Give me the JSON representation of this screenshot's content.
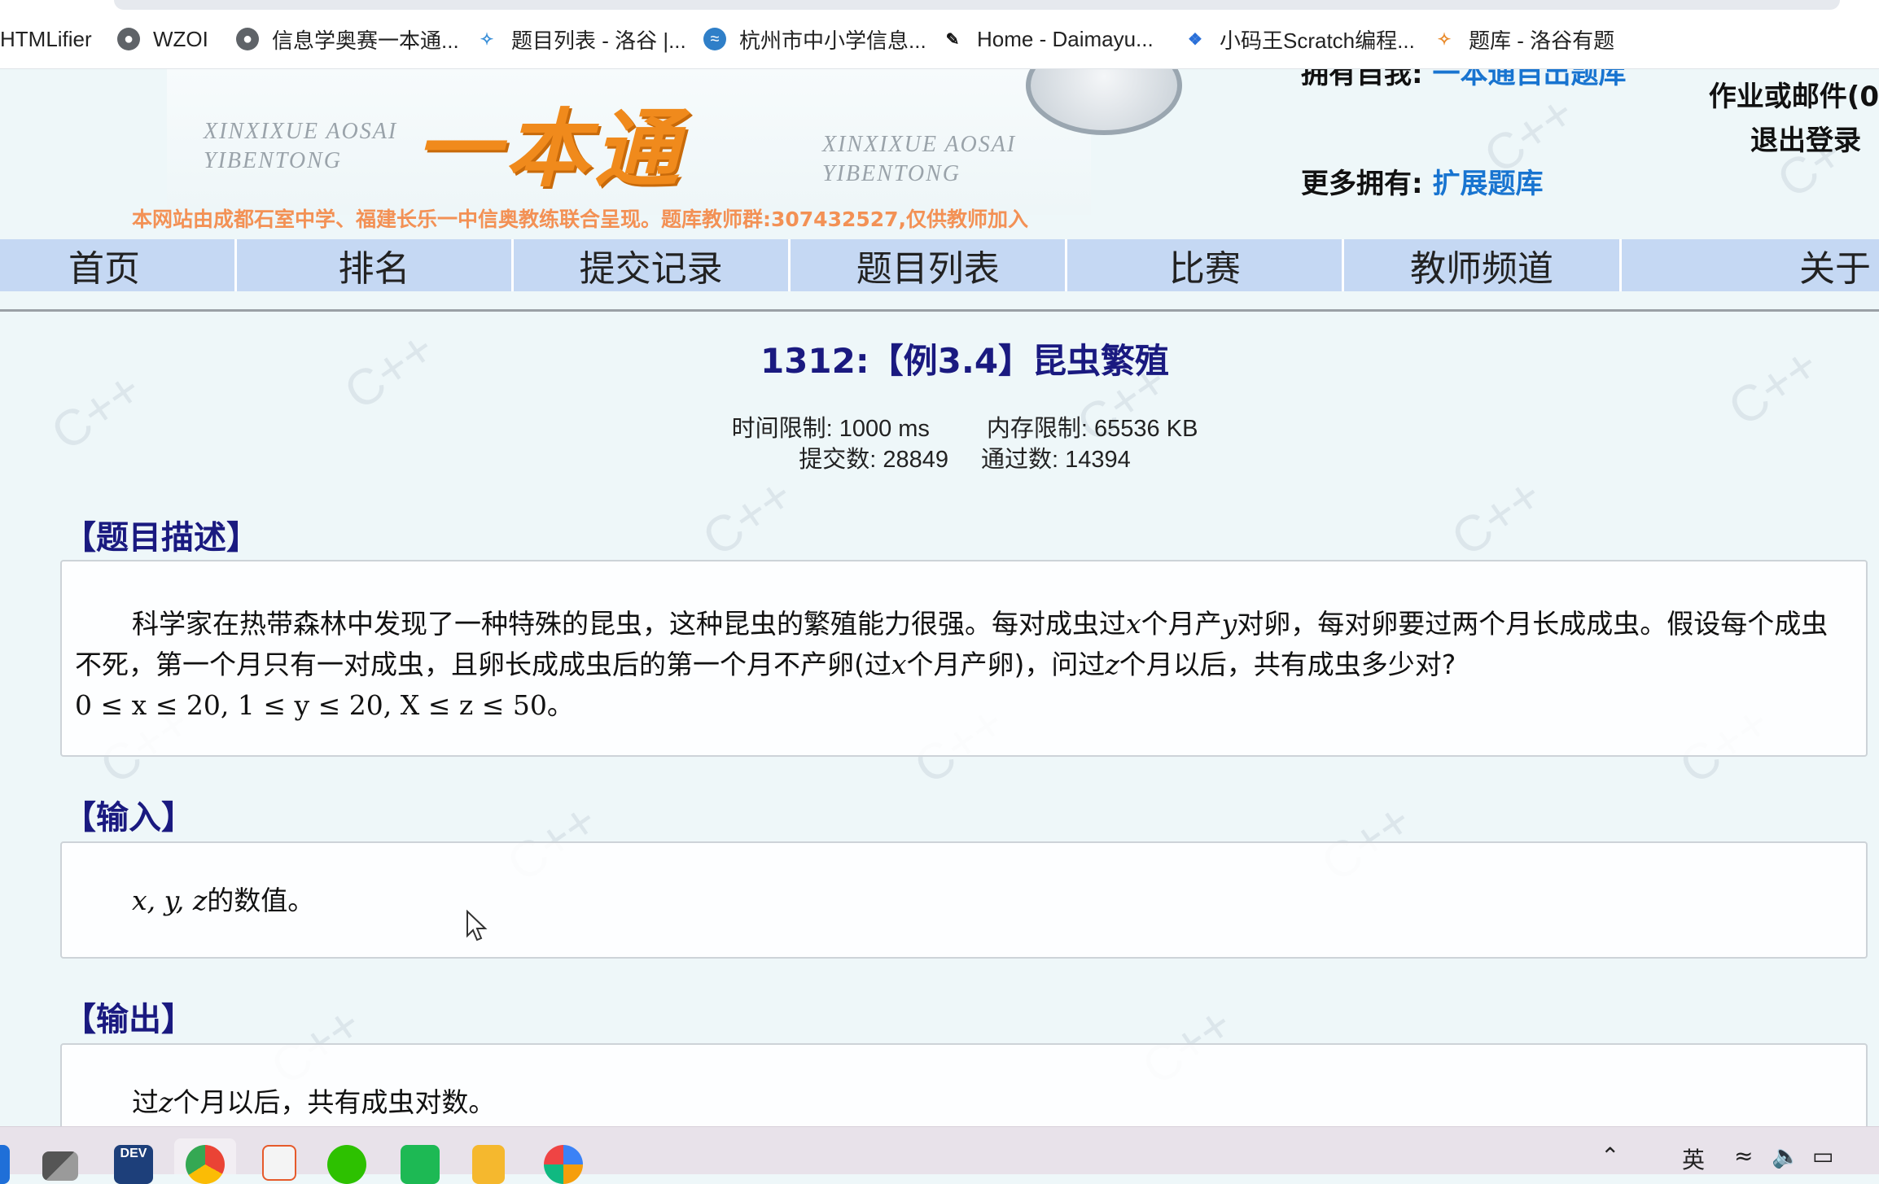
{
  "bookmarks": [
    {
      "label": "HTMLifier",
      "icon": "none"
    },
    {
      "label": "WZOI",
      "icon": "globe-icon"
    },
    {
      "label": "信息学奥赛一本通...",
      "icon": "globe-icon"
    },
    {
      "label": "题目列表 - 洛谷 |...",
      "icon": "luogu-icon"
    },
    {
      "label": "杭州市中小学信息...",
      "icon": "hangzhou-icon"
    },
    {
      "label": "Home - Daimayu...",
      "icon": "daimayu-icon"
    },
    {
      "label": "小码王Scratch编程...",
      "icon": "xiaomawang-icon"
    },
    {
      "label": "题库 - 洛谷有题",
      "icon": "luogu-icon"
    }
  ],
  "header": {
    "pinyin_left": [
      "XINXIXUE AOSAI",
      "YIBENTONG"
    ],
    "pinyin_right": [
      "XINXIXUE AOSAI",
      "YIBENTONG"
    ],
    "logo_text": "一本通",
    "notice": "本网站由成都石室中学、福建长乐一中信奥教练联合呈现。题库教师群:307432527,仅供教师加入",
    "own_label": "拥有自我:",
    "own_link": "一本通自出题库",
    "more_label": "更多拥有:",
    "more_link": "扩展题库",
    "user_mail": "作业或邮件(0",
    "logout": "退出登录"
  },
  "nav": [
    "首页",
    "排名",
    "提交记录",
    "题目列表",
    "比赛",
    "教师频道",
    "关于"
  ],
  "problem": {
    "title": "1312:【例3.4】昆虫繁殖",
    "time_limit": "时间限制: 1000 ms",
    "memory_limit": "内存限制: 65536 KB",
    "submissions": "提交数: 28849",
    "accepted": "通过数: 14394",
    "desc_heading": "【题目描述】",
    "desc_p1": "科学家在热带森林中发现了一种特殊的昆虫，这种昆虫的繁殖能力很强。每对成虫过",
    "desc_var_x": "x",
    "desc_p2": "个月产",
    "desc_var_y": "y",
    "desc_p3": "对卵，每对卵要过两个月长成成虫。假设每个成虫不死，第一个月只有一对成虫，且卵长成成虫后的第一个月不产卵(过",
    "desc_var_x2": "x",
    "desc_p4": "个月产卵)，问过",
    "desc_var_z": "z",
    "desc_p5": "个月以后，共有成虫多少对?",
    "constraint": "0 ≤ x ≤ 20, 1 ≤ y ≤ 20, X ≤ z ≤ 50。",
    "input_heading": "【输入】",
    "input_vars": "x, y, z",
    "input_text": "的数值。",
    "output_heading": "【输出】",
    "output_pre": "过",
    "output_var": "z",
    "output_text": "个月以后，共有成虫对数。"
  },
  "taskbar": {
    "apps": [
      "start-icon",
      "task-view-icon",
      "dev-cpp-icon",
      "chrome-icon",
      "slides-icon",
      "wechat-icon",
      "scratch-icon",
      "notes-icon",
      "paint-icon"
    ],
    "tray_lang": "英"
  },
  "colors": {
    "title": "#1a1a80",
    "link": "#1874d0",
    "nav_bg": "#c5d8f3",
    "notice": "#f39155",
    "logo": "#f08a1c"
  }
}
